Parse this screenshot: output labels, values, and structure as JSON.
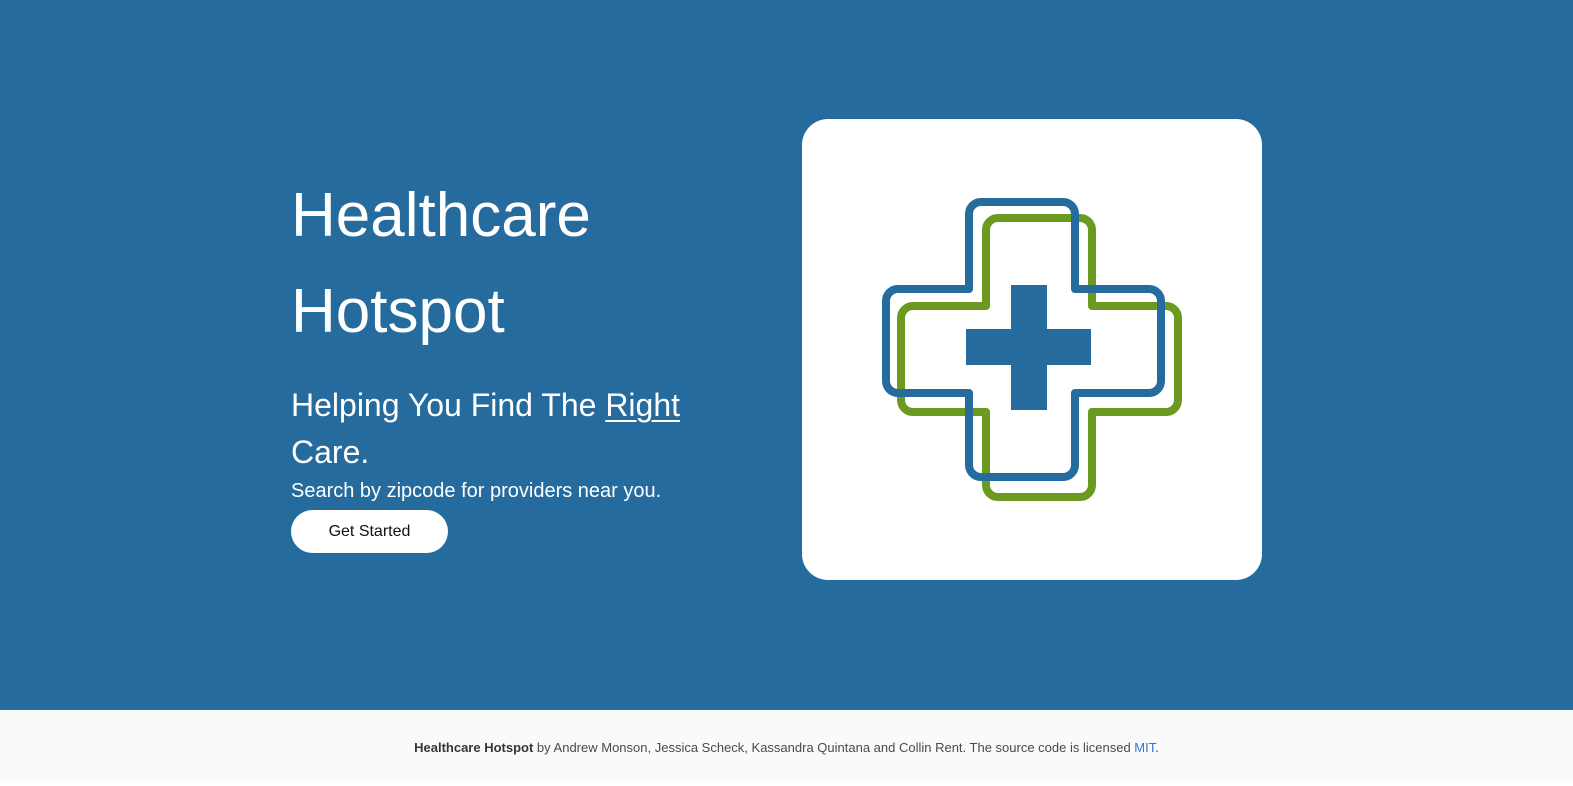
{
  "hero": {
    "title_line1": "Healthcare",
    "title_line2": "Hotspot",
    "subtitle_pre": "Helping You Find The ",
    "subtitle_emph": "Right",
    "subtitle_post": "Care.",
    "description": "Search by zipcode for providers near you.",
    "cta_label": "Get Started"
  },
  "logo": {
    "icon": "medical-cross-logo-icon",
    "primary_color": "#256b9e",
    "secondary_color": "#6a9a1f"
  },
  "footer": {
    "brand": "Healthcare Hotspot",
    "credits": " by Andrew Monson, Jessica Scheck, Kassandra Quintana and Collin Rent. The source code is licensed ",
    "license_link": "MIT",
    "end": "."
  },
  "colors": {
    "hero_background": "#256b9e",
    "footer_background": "#fafafa",
    "link": "#3273dc"
  }
}
